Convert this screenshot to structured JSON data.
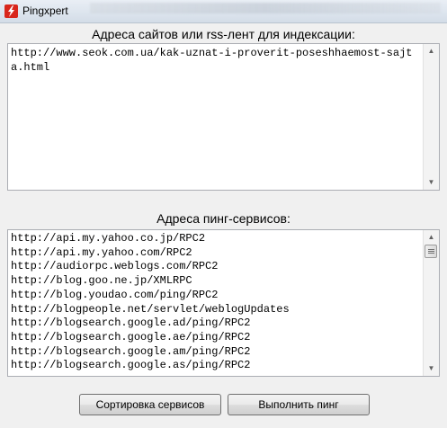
{
  "window": {
    "title": "Pingxpert",
    "icon": "lightning-icon",
    "accent": "#d8261c"
  },
  "sites": {
    "label": "Адреса сайтов или rss-лент для индексации:",
    "value": "http://www.seok.com.ua/kak-uznat-i-proverit-poseshhaemost-sajta.html"
  },
  "services": {
    "label": "Адреса пинг-сервисов:",
    "items": [
      "http://api.my.yahoo.co.jp/RPC2",
      "http://api.my.yahoo.com/RPC2",
      "http://audiorpc.weblogs.com/RPC2",
      "http://blog.goo.ne.jp/XMLRPC",
      "http://blog.youdao.com/ping/RPC2",
      "http://blogpeople.net/servlet/weblogUpdates",
      "http://blogsearch.google.ad/ping/RPC2",
      "http://blogsearch.google.ae/ping/RPC2",
      "http://blogsearch.google.am/ping/RPC2",
      "http://blogsearch.google.as/ping/RPC2"
    ]
  },
  "buttons": {
    "sort": "Сортировка сервисов",
    "ping": "Выполнить пинг"
  }
}
